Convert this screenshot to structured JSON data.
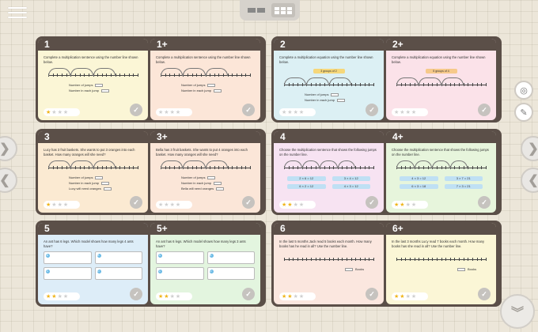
{
  "top": {
    "menu_icon": "hamburger-icon",
    "views": [
      "two-column-view",
      "grid-view"
    ]
  },
  "groups": [
    {
      "cards": [
        {
          "id": "1",
          "prompt": "Complete a multiplication sentence using the number line shown below.",
          "fields": [
            "Number of jumps",
            "Number in each jump"
          ],
          "stars": 1,
          "color": "#fbf6d6"
        },
        {
          "id": "1+",
          "prompt": "Complete a multiplication sentence using the number line shown below.",
          "fields": [
            "Number of jumps",
            "Number in each jump"
          ],
          "stars": 0,
          "color": "#fce6d8"
        }
      ]
    },
    {
      "cards": [
        {
          "id": "2",
          "prompt": "Complete a multiplication equation using the number line shown below.",
          "banner": "3 groups of 2",
          "fields": [
            "Number of jumps",
            "Number in each jump"
          ],
          "stars": 0,
          "color": "#dcf0f4"
        },
        {
          "id": "2+",
          "prompt": "Complete a multiplication equation using the number line shown below.",
          "banner": "5 groups of 4",
          "fields": [],
          "stars": 0,
          "color": "#fbe2e9"
        }
      ]
    },
    {
      "cards": [
        {
          "id": "3",
          "prompt": "Lucy has 3 fruit baskets. She wants to put 3 oranges into each basket. How many oranges will she need?",
          "fields": [
            "Number of jumps",
            "Number in each jump",
            "Lucy will need oranges"
          ],
          "stars": 1,
          "color": "#fbead2"
        },
        {
          "id": "3+",
          "prompt": "Bella has 3 fruit baskets. She wants to put 4 oranges into each basket. How many oranges will she need?",
          "fields": [
            "Number of jumps",
            "Number in each jump",
            "Bella will need oranges"
          ],
          "stars": 0,
          "color": "#fbe6d8"
        }
      ]
    },
    {
      "cards": [
        {
          "id": "4",
          "prompt": "Choose the multiplication sentence that shows the following jumps on the number line.",
          "answers": [
            "2 × 6 = 12",
            "3 × 4 = 12",
            "6 × 2 = 12",
            "4 × 3 = 12"
          ],
          "stars": 2,
          "color": "#f7e3f2"
        },
        {
          "id": "4+",
          "prompt": "Choose the multiplication sentence that shows the following jumps on the number line.",
          "answers": [
            "4 × 3 = 12",
            "3 × 7 = 21",
            "6 × 3 = 18",
            "7 × 3 = 21"
          ],
          "stars": 2,
          "color": "#e7f5dc"
        }
      ]
    },
    {
      "cards": [
        {
          "id": "5",
          "prompt": "An ant has 6 legs. Which model shows how many legs 4 ants have?",
          "models": [
            "A",
            "B",
            "C",
            "D"
          ],
          "stars": 2,
          "color": "#ddedf8"
        },
        {
          "id": "5+",
          "prompt": "An ant has 6 legs. Which model shows how many legs 3 ants have?",
          "models": [
            "A",
            "B",
            "C",
            "D"
          ],
          "stars": 2,
          "color": "#e3f5df"
        }
      ]
    },
    {
      "cards": [
        {
          "id": "6",
          "prompt": "In the last 5 months Jack read 5 books each month. How many books has he read in all? Use the number line.",
          "unit": "Books",
          "stars": 2,
          "color": "#fbe7df"
        },
        {
          "id": "6+",
          "prompt": "In the last 3 months Lucy read 7 books each month. How many books has she read in all? Use the number line.",
          "unit": "Books",
          "stars": 2,
          "color": "#fbf6d6"
        }
      ]
    }
  ]
}
